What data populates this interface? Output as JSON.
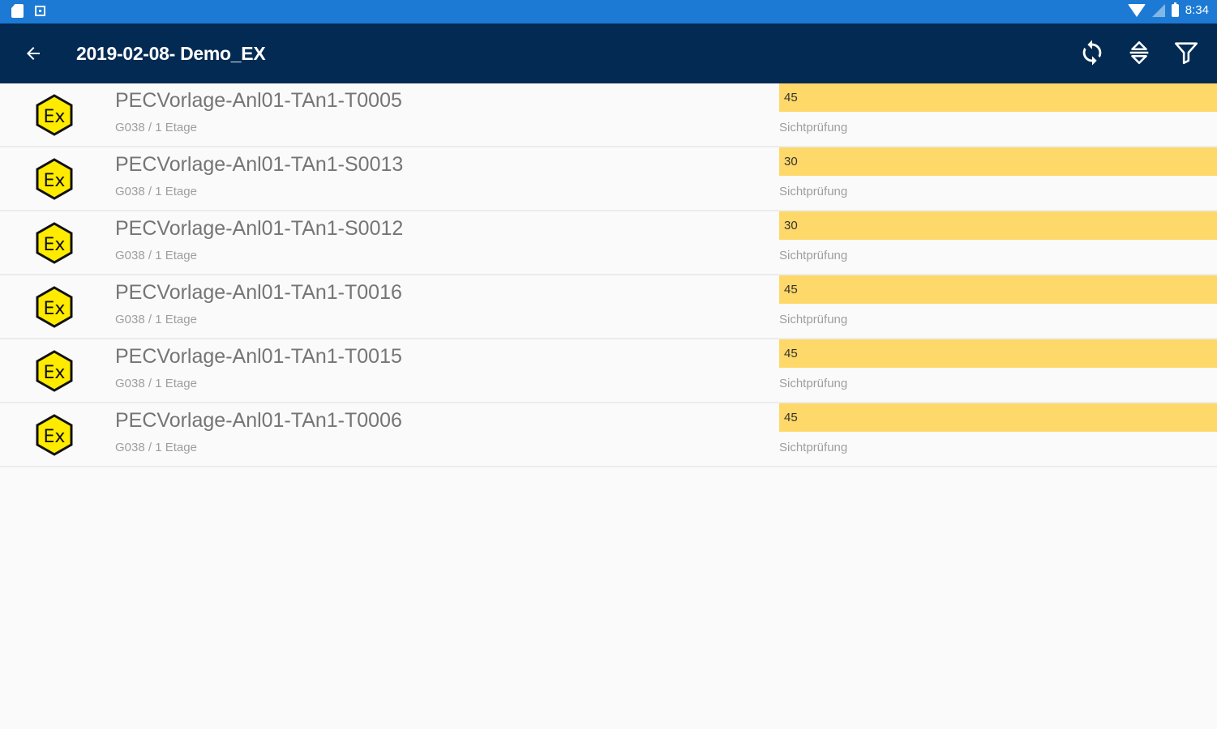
{
  "status_bar": {
    "time": "8:34",
    "icons": [
      "notification-doc-icon",
      "notification-square-icon",
      "wifi-icon",
      "cell-signal-icon",
      "battery-icon"
    ]
  },
  "app_bar": {
    "title": "2019-02-08- Demo_EX",
    "back_icon": "arrow-left-icon",
    "actions": [
      "sync-icon",
      "sort-icon",
      "filter-icon"
    ],
    "background": "#022a52"
  },
  "colors": {
    "status_bar": "#1c7ad4",
    "progress_bar": "#fed868",
    "ex_badge": "#ffeb00"
  },
  "items": [
    {
      "name": "PECVorlage-Anl01-TAn1-T0005",
      "location": "G038 / 1 Etage",
      "value": "45",
      "check": "Sichtprüfung"
    },
    {
      "name": "PECVorlage-Anl01-TAn1-S0013",
      "location": "G038 / 1 Etage",
      "value": "30",
      "check": "Sichtprüfung"
    },
    {
      "name": "PECVorlage-Anl01-TAn1-S0012",
      "location": "G038 / 1 Etage",
      "value": "30",
      "check": "Sichtprüfung"
    },
    {
      "name": "PECVorlage-Anl01-TAn1-T0016",
      "location": "G038 / 1 Etage",
      "value": "45",
      "check": "Sichtprüfung"
    },
    {
      "name": "PECVorlage-Anl01-TAn1-T0015",
      "location": "G038 / 1 Etage",
      "value": "45",
      "check": "Sichtprüfung"
    },
    {
      "name": "PECVorlage-Anl01-TAn1-T0006",
      "location": "G038 / 1 Etage",
      "value": "45",
      "check": "Sichtprüfung"
    }
  ]
}
